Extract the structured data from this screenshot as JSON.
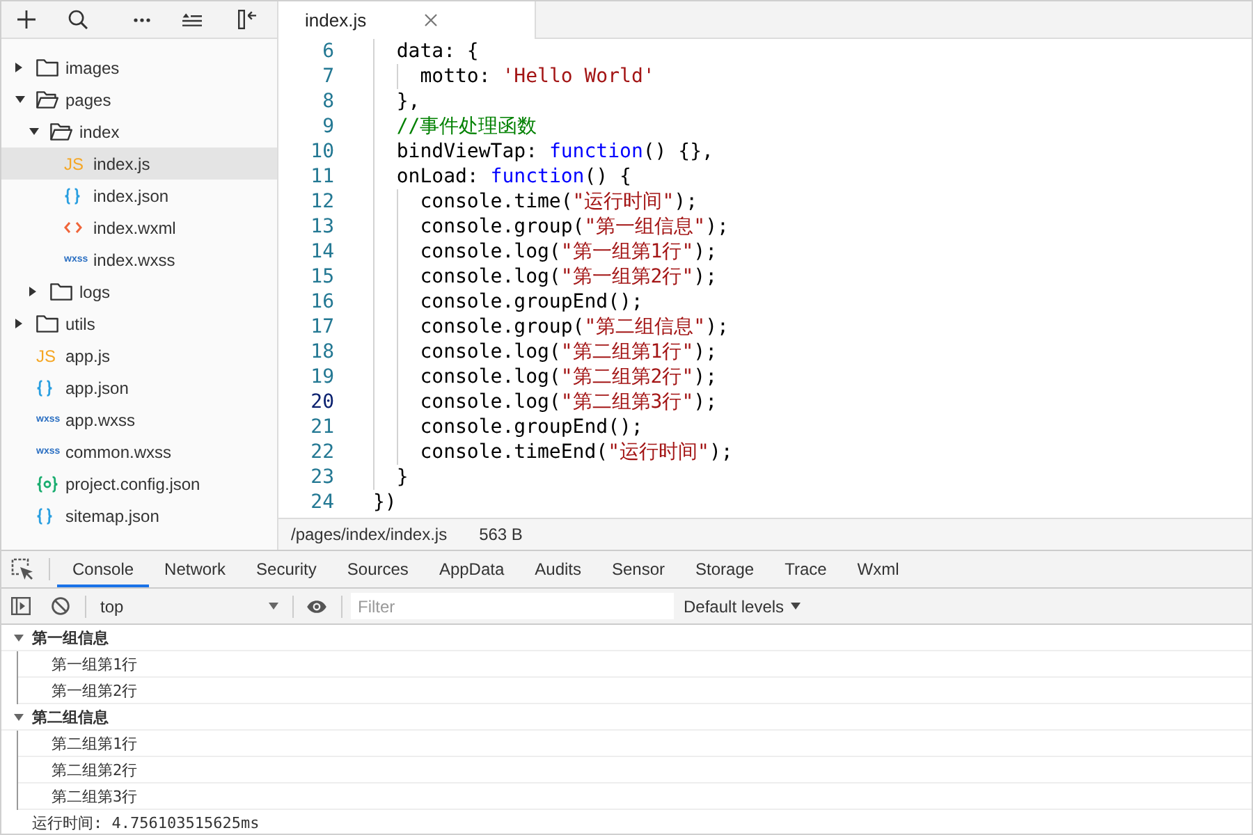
{
  "sidebar": {
    "tree": [
      {
        "label": "images",
        "kind": "folder",
        "expanded": false,
        "selected": false
      },
      {
        "label": "pages",
        "kind": "folder",
        "expanded": true,
        "selected": false,
        "children": [
          {
            "label": "index",
            "kind": "folder",
            "expanded": true,
            "selected": false,
            "children": [
              {
                "label": "index.js",
                "kind": "js",
                "badge": "JS",
                "selected": true
              },
              {
                "label": "index.json",
                "kind": "json",
                "selected": false
              },
              {
                "label": "index.wxml",
                "kind": "wxml",
                "selected": false
              },
              {
                "label": "index.wxss",
                "kind": "wxss",
                "badge": "wxss",
                "selected": false
              }
            ]
          },
          {
            "label": "logs",
            "kind": "folder",
            "expanded": false,
            "selected": false
          }
        ]
      },
      {
        "label": "utils",
        "kind": "folder",
        "expanded": false,
        "selected": false
      },
      {
        "label": "app.js",
        "kind": "js",
        "badge": "JS",
        "selected": false
      },
      {
        "label": "app.json",
        "kind": "json",
        "selected": false
      },
      {
        "label": "app.wxss",
        "kind": "wxss",
        "badge": "wxss",
        "selected": false
      },
      {
        "label": "common.wxss",
        "kind": "wxss",
        "badge": "wxss",
        "selected": false
      },
      {
        "label": "project.config.json",
        "kind": "config",
        "selected": false
      },
      {
        "label": "sitemap.json",
        "kind": "json",
        "selected": false
      }
    ]
  },
  "editor": {
    "tabs": [
      {
        "label": "index.js",
        "selected": true
      }
    ],
    "lines": [
      {
        "number": "6",
        "current": false,
        "tokens": [
          {
            "kind": "plain",
            "text": "  data: {"
          }
        ]
      },
      {
        "number": "7",
        "current": false,
        "tokens": [
          {
            "kind": "plain",
            "text": "    motto: "
          },
          {
            "kind": "string",
            "text": "'Hello World'"
          }
        ]
      },
      {
        "number": "8",
        "current": false,
        "tokens": [
          {
            "kind": "plain",
            "text": "  },"
          }
        ]
      },
      {
        "number": "9",
        "current": false,
        "tokens": [
          {
            "kind": "comment",
            "text": "  //事件处理函数"
          }
        ]
      },
      {
        "number": "10",
        "current": false,
        "tokens": [
          {
            "kind": "plain",
            "text": "  bindViewTap: "
          },
          {
            "kind": "keyword",
            "text": "function"
          },
          {
            "kind": "plain",
            "text": "() {},"
          }
        ]
      },
      {
        "number": "11",
        "current": false,
        "tokens": [
          {
            "kind": "plain",
            "text": "  onLoad: "
          },
          {
            "kind": "keyword",
            "text": "function"
          },
          {
            "kind": "plain",
            "text": "() {"
          }
        ]
      },
      {
        "number": "12",
        "current": false,
        "tokens": [
          {
            "kind": "plain",
            "text": "    console.time("
          },
          {
            "kind": "string",
            "text": "\"运行时间\""
          },
          {
            "kind": "plain",
            "text": ");"
          }
        ]
      },
      {
        "number": "13",
        "current": false,
        "tokens": [
          {
            "kind": "plain",
            "text": "    console.group("
          },
          {
            "kind": "string",
            "text": "\"第一组信息\""
          },
          {
            "kind": "plain",
            "text": ");"
          }
        ]
      },
      {
        "number": "14",
        "current": false,
        "tokens": [
          {
            "kind": "plain",
            "text": "    console.log("
          },
          {
            "kind": "string",
            "text": "\"第一组第1行\""
          },
          {
            "kind": "plain",
            "text": ");"
          }
        ]
      },
      {
        "number": "15",
        "current": false,
        "tokens": [
          {
            "kind": "plain",
            "text": "    console.log("
          },
          {
            "kind": "string",
            "text": "\"第一组第2行\""
          },
          {
            "kind": "plain",
            "text": ");"
          }
        ]
      },
      {
        "number": "16",
        "current": false,
        "tokens": [
          {
            "kind": "plain",
            "text": "    console.groupEnd();"
          }
        ]
      },
      {
        "number": "17",
        "current": false,
        "tokens": [
          {
            "kind": "plain",
            "text": "    console.group("
          },
          {
            "kind": "string",
            "text": "\"第二组信息\""
          },
          {
            "kind": "plain",
            "text": ");"
          }
        ]
      },
      {
        "number": "18",
        "current": false,
        "tokens": [
          {
            "kind": "plain",
            "text": "    console.log("
          },
          {
            "kind": "string",
            "text": "\"第二组第1行\""
          },
          {
            "kind": "plain",
            "text": ");"
          }
        ]
      },
      {
        "number": "19",
        "current": false,
        "tokens": [
          {
            "kind": "plain",
            "text": "    console.log("
          },
          {
            "kind": "string",
            "text": "\"第二组第2行\""
          },
          {
            "kind": "plain",
            "text": ");"
          }
        ]
      },
      {
        "number": "20",
        "current": true,
        "tokens": [
          {
            "kind": "plain",
            "text": "    console.log("
          },
          {
            "kind": "string",
            "text": "\"第二组第3行\""
          },
          {
            "kind": "plain",
            "text": ");"
          }
        ]
      },
      {
        "number": "21",
        "current": false,
        "tokens": [
          {
            "kind": "plain",
            "text": "    console.groupEnd();"
          }
        ]
      },
      {
        "number": "22",
        "current": false,
        "tokens": [
          {
            "kind": "plain",
            "text": "    console.timeEnd("
          },
          {
            "kind": "string",
            "text": "\"运行时间\""
          },
          {
            "kind": "plain",
            "text": ");"
          }
        ]
      },
      {
        "number": "23",
        "current": false,
        "tokens": [
          {
            "kind": "plain",
            "text": "  }"
          }
        ]
      },
      {
        "number": "24",
        "current": false,
        "tokens": [
          {
            "kind": "plain",
            "text": "})"
          }
        ]
      }
    ],
    "status": {
      "path": "/pages/index/index.js",
      "size": "563 B"
    }
  },
  "devtools": {
    "tabs": [
      {
        "label": "Console",
        "selected": true
      },
      {
        "label": "Network",
        "selected": false
      },
      {
        "label": "Security",
        "selected": false
      },
      {
        "label": "Sources",
        "selected": false
      },
      {
        "label": "AppData",
        "selected": false
      },
      {
        "label": "Audits",
        "selected": false
      },
      {
        "label": "Sensor",
        "selected": false
      },
      {
        "label": "Storage",
        "selected": false
      },
      {
        "label": "Trace",
        "selected": false
      },
      {
        "label": "Wxml",
        "selected": false
      }
    ],
    "console": {
      "context": "top",
      "filter": {
        "placeholder": "Filter"
      },
      "levels": "Default levels",
      "entries": [
        {
          "kind": "group",
          "label": "第一组信息",
          "expanded": true,
          "children": [
            {
              "kind": "log",
              "text": "第一组第1行"
            },
            {
              "kind": "log",
              "text": "第一组第2行"
            }
          ]
        },
        {
          "kind": "group",
          "label": "第二组信息",
          "expanded": true,
          "children": [
            {
              "kind": "log",
              "text": "第二组第1行"
            },
            {
              "kind": "log",
              "text": "第二组第2行"
            },
            {
              "kind": "log",
              "text": "第二组第3行"
            }
          ]
        },
        {
          "kind": "log",
          "text": "运行时间: 4.756103515625ms"
        }
      ]
    }
  }
}
